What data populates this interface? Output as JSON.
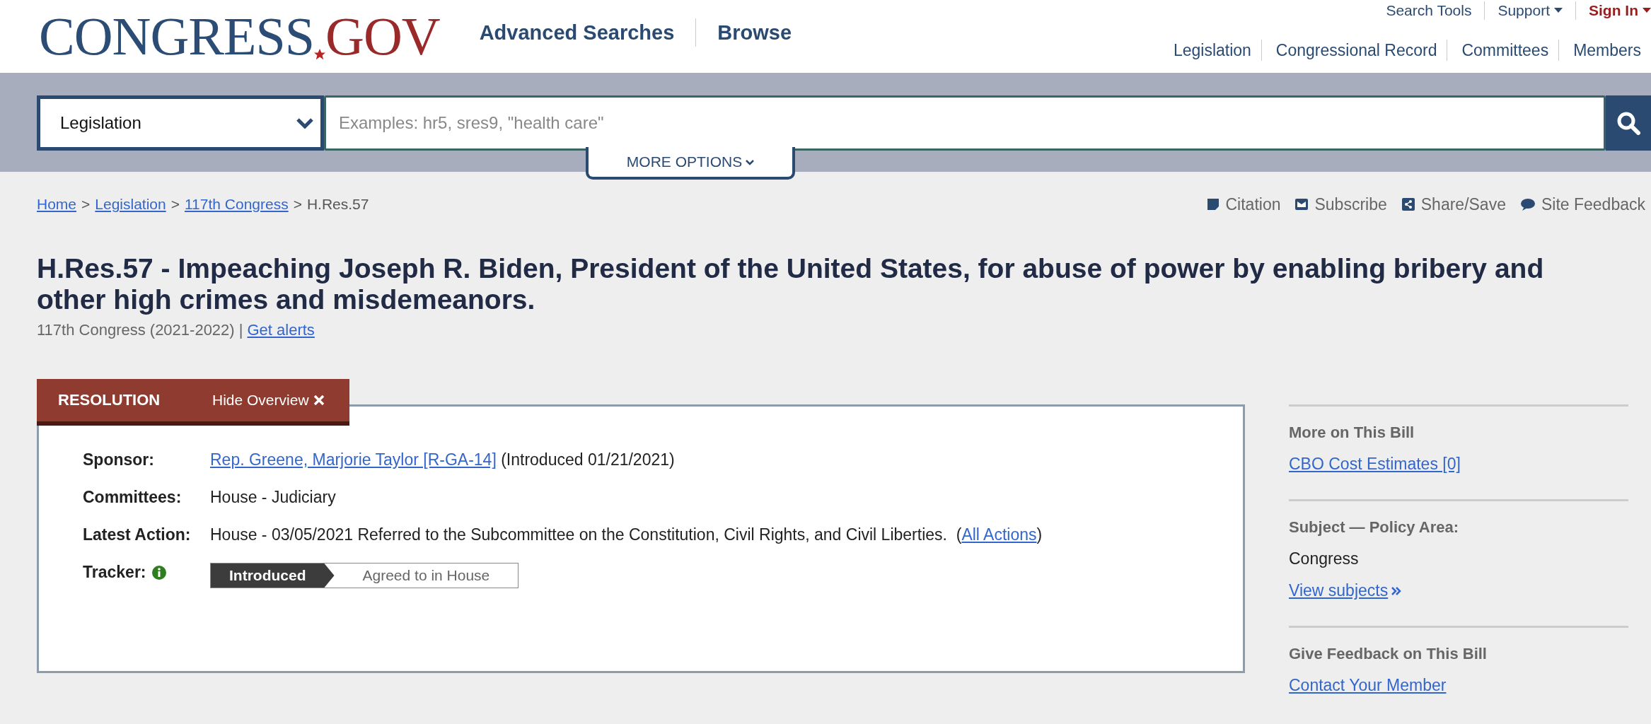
{
  "header": {
    "logo": {
      "left": "CONGRESS",
      "right": "GOV"
    },
    "main_nav": [
      {
        "label": "Advanced Searches"
      },
      {
        "label": "Browse"
      }
    ],
    "utility_nav": [
      {
        "label": "Search Tools",
        "dropdown": false,
        "emphasized": false
      },
      {
        "label": "Support",
        "dropdown": true,
        "emphasized": false
      },
      {
        "label": "Sign In",
        "dropdown": true,
        "emphasized": true
      }
    ],
    "section_nav": [
      {
        "label": "Legislation"
      },
      {
        "label": "Congressional Record"
      },
      {
        "label": "Committees"
      },
      {
        "label": "Members"
      }
    ]
  },
  "search": {
    "collection": "Legislation",
    "placeholder": "Examples: hr5, sres9, \"health care\"",
    "more_options": "MORE OPTIONS"
  },
  "breadcrumb": [
    {
      "label": "Home",
      "link": true
    },
    {
      "label": "Legislation",
      "link": true
    },
    {
      "label": "117th Congress",
      "link": true
    },
    {
      "label": "H.Res.57",
      "link": false
    }
  ],
  "breadcrumb_separator": ">",
  "page_actions": [
    {
      "label": "Citation"
    },
    {
      "label": "Subscribe"
    },
    {
      "label": "Share/Save"
    },
    {
      "label": "Site Feedback"
    }
  ],
  "title": "H.Res.57 - Impeaching Joseph R. Biden, President of the United States, for abuse of power by enabling bribery and other high crimes and misdemeanors.",
  "congress": "117th Congress (2021-2022) |",
  "alerts_link": "Get alerts",
  "overview": {
    "type_label": "RESOLUTION",
    "hide_label": "Hide Overview",
    "rows": [
      {
        "label": "Sponsor:",
        "parts": [
          {
            "text": "Rep. Greene, Marjorie Taylor [R-GA-14]",
            "link": true
          },
          {
            "text": " (Introduced 01/21/2021)",
            "link": false
          }
        ]
      },
      {
        "label": "Committees:",
        "parts": [
          {
            "text": "House - Judiciary",
            "link": false
          }
        ]
      },
      {
        "label": "Latest Action:",
        "parts": [
          {
            "text": "House - 03/05/2021 Referred to the Subcommittee on the Constitution, Civil Rights, and Civil Liberties.  (",
            "link": false
          },
          {
            "text": "All Actions",
            "link": true
          },
          {
            "text": ")",
            "link": false
          }
        ]
      }
    ],
    "tracker_label": "Tracker:",
    "tracker": [
      {
        "label": "Introduced",
        "selected": true
      },
      {
        "label": "Agreed to in House",
        "selected": false
      }
    ]
  },
  "sidebar": [
    {
      "heading": "More on This Bill",
      "items": [
        {
          "kind": "link",
          "text": "CBO Cost Estimates [0]"
        }
      ]
    },
    {
      "heading": "Subject — Policy Area:",
      "items": [
        {
          "kind": "text",
          "text": "Congress"
        },
        {
          "kind": "more_link",
          "text": "View subjects"
        }
      ]
    },
    {
      "heading": "Give Feedback on This Bill",
      "items": [
        {
          "kind": "link",
          "text": "Contact Your Member"
        }
      ]
    }
  ]
}
